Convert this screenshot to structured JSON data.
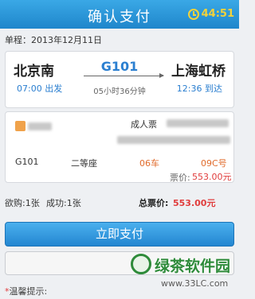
{
  "header": {
    "title": "确认支付",
    "countdown": "44:51"
  },
  "trip": {
    "date_label": "单程：2013年12月11日",
    "from_station": "北京南",
    "to_station": "上海虹桥",
    "train_no": "G101",
    "depart_time": "07:00 出发",
    "arrive_time": "12:36 到达",
    "duration": "05小时36分钟"
  },
  "passenger": {
    "ticket_type": "成人票",
    "train_no": "G101",
    "seat_class": "二等座",
    "car": "06车",
    "seat": "09C号",
    "price_label": "票价:",
    "price_value": "553.00元"
  },
  "summary": {
    "want_label": "欲购:1张",
    "success_label": "成功:1张",
    "total_label": "总票价:",
    "total_value": "553.00元"
  },
  "actions": {
    "pay_label": "立即支付"
  },
  "tips": {
    "star": "*",
    "label": "温馨提示:"
  },
  "watermark": {
    "main": "绿茶软件园",
    "url": "www.33LC.com"
  },
  "colors": {
    "header_blue": "#2a95d8",
    "accent_blue": "#2b7fd0",
    "price_red": "#e03c3c"
  }
}
